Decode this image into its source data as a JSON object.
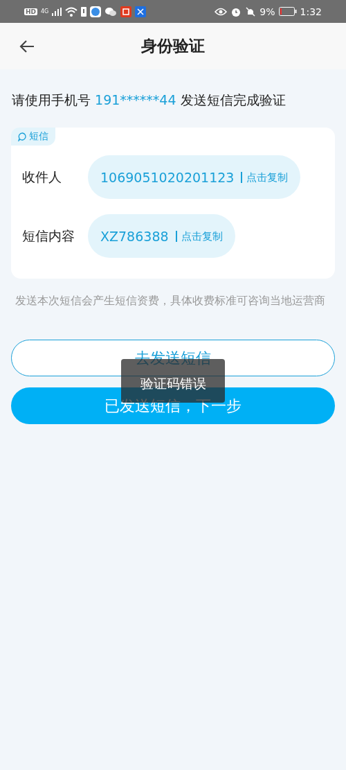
{
  "status_bar": {
    "left": [
      "HD",
      "4G"
    ],
    "battery": "9%",
    "time": "1:32"
  },
  "header": {
    "title": "身份验证"
  },
  "instruction": {
    "before": "请使用手机号 ",
    "phone": "191******44",
    "after": " 发送短信完成验证"
  },
  "sms_card": {
    "tag": "短信",
    "rows": [
      {
        "label": "收件人",
        "value": "1069051020201123",
        "copy": "点击复制"
      },
      {
        "label": "短信内容",
        "value": "XZ786388",
        "copy": "点击复制"
      }
    ]
  },
  "note": "发送本次短信会产生短信资费，具体收费标准可咨询当地运营商",
  "buttons": [
    {
      "label": "去发送短信",
      "kind": "outline"
    },
    {
      "label": "已发送短信，下一步",
      "kind": "primary"
    }
  ],
  "toast": "验证码错误"
}
